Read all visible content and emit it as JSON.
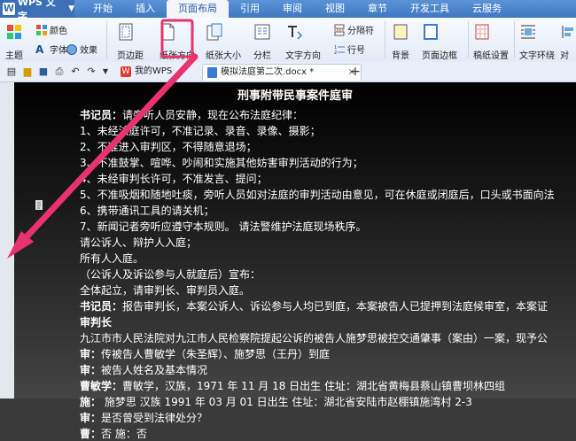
{
  "app": {
    "name": "WPS 文字"
  },
  "menu": {
    "tabs": [
      "开始",
      "插入",
      "页面布局",
      "引用",
      "审阅",
      "视图",
      "章节",
      "开发工具",
      "云服务"
    ]
  },
  "ribbon": {
    "theme": "主题",
    "colors": "颜色",
    "fonts": "字体",
    "effects": "效果",
    "margins": "页边距",
    "orientation": "纸张方向",
    "size": "纸张大小",
    "columns": "分栏",
    "text_direction": "文字方向",
    "breaks": "分隔符",
    "line_numbers": "行号",
    "background": "背景",
    "page_border": "页面边框",
    "draft_paper": "稿纸设置",
    "wrap": "文字环绕",
    "align": "对"
  },
  "tabs": {
    "wps": "我的WPS",
    "doc": "模拟法庭第二次.docx *",
    "add": "+"
  },
  "document": {
    "title": "刑事附带民事案件庭审",
    "lines": [
      {
        "lead": "书记员：",
        "text": "请旁听人员安静，现在公布法庭纪律："
      },
      {
        "lead": "",
        "text": "1、未经法庭许可，不准记录、录音、录像、摄影；"
      },
      {
        "lead": "",
        "text": "2、不准进入审判区，不得随意退场；"
      },
      {
        "lead": "",
        "text": "3、不准鼓掌、喧哗、吵闹和实施其他妨害审判活动的行为；"
      },
      {
        "lead": "",
        "text": "4、未经审判长许可，不准发言、提问；"
      },
      {
        "lead": "",
        "text": "5、不准吸烟和随地吐痰，旁听人员如对法庭的审判活动由意见，可在休庭或闭庭后，口头或书面向法"
      },
      {
        "lead": "",
        "text": "6、携带通讯工具的请关机；"
      },
      {
        "lead": "",
        "text": "7、新闻记者旁听应遵守本规则。    请法警维护法庭现场秩序。"
      },
      {
        "lead": "",
        "text": "请公诉人、辩护人入庭；"
      },
      {
        "lead": "",
        "text": "所有人入庭。"
      },
      {
        "lead": "",
        "text": "（公诉人及诉讼参与人就庭后）宣布："
      },
      {
        "lead": "",
        "text": "全体起立，请审判长、审判员入庭。"
      },
      {
        "lead": "书记员：",
        "text": "报告审判长，本案公诉人、诉讼参与人均已到庭，本案被告人已提押到法庭候审室，本案证"
      },
      {
        "lead": "审判长",
        "text": ""
      },
      {
        "lead": "",
        "text": "  九江市市人民法院对九江市人民检察院提起公诉的被告人施梦思被控交通肇事（案由）一案，现予公"
      },
      {
        "lead": "审：",
        "text": "传被告人曹敏学（朱圣辉）、施梦思（王丹）到庭"
      },
      {
        "lead": "审：",
        "text": "被告人姓名及基本情况"
      },
      {
        "lead": "曹敏学：",
        "text": "曹敏学，汉族，1971 年 11 月 18 日出生  住址：湖北省黄梅县蔡山镇曹坝林四组"
      },
      {
        "lead": "施：",
        "text": "  施梦思  汉族  1991 年 03 月 01 日出生  住址：湖北省安陆市赵棚镇施湾村 2-3"
      },
      {
        "lead": "审：",
        "text": "是否曾受到法律处分？"
      },
      {
        "lead": "曹：",
        "text": "否    施：否"
      }
    ]
  },
  "colors": {
    "accent": "#e8336d",
    "title_bar": "#4a86cf"
  }
}
